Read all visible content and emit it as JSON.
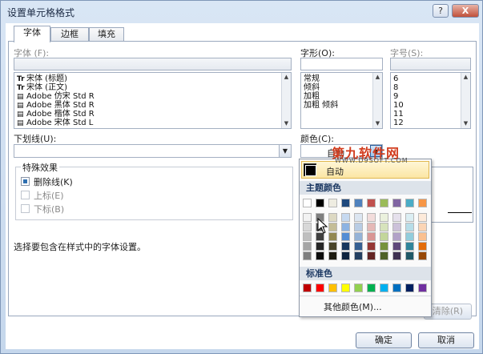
{
  "window": {
    "title": "设置单元格格式",
    "help_label": "?",
    "close_label": "X"
  },
  "tabs": [
    {
      "label": "字体"
    },
    {
      "label": "边框"
    },
    {
      "label": "填充"
    }
  ],
  "font": {
    "label": "字体 (F):",
    "value": "",
    "items": [
      {
        "icon": "Tr",
        "label": "宋体 (标题)"
      },
      {
        "icon": "Tr",
        "label": "宋体 (正文)"
      },
      {
        "icon": "",
        "label": "Adobe 仿宋 Std R"
      },
      {
        "icon": "",
        "label": "Adobe 黑体 Std R"
      },
      {
        "icon": "",
        "label": "Adobe 楷体 Std R"
      },
      {
        "icon": "",
        "label": "Adobe 宋体 Std L"
      }
    ]
  },
  "style": {
    "label": "字形(O):",
    "value": "",
    "items": [
      "常规",
      "倾斜",
      "加粗",
      "加粗 倾斜"
    ]
  },
  "size": {
    "label": "字号(S):",
    "value": "",
    "items": [
      "6",
      "8",
      "9",
      "10",
      "11",
      "12"
    ]
  },
  "underline": {
    "label": "下划线(U):",
    "value": ""
  },
  "color": {
    "label": "颜色(C):",
    "value": "自动"
  },
  "effects": {
    "title": "特殊效果",
    "strikethrough": "删除线(K)",
    "superscript": "上标(E)",
    "subscript": "下标(B)"
  },
  "hint": "选择要包含在样式中的字体设置。",
  "watermark": {
    "title": "第九软件网",
    "url": "WWW.D9SOFT.COM"
  },
  "color_popup": {
    "auto_label": "自动",
    "theme_header": "主题颜色",
    "standard_header": "标准色",
    "more_label": "其他颜色(M)...",
    "theme_top": [
      "#ffffff",
      "#000000",
      "#eeece1",
      "#1f497d",
      "#4f81bd",
      "#c0504d",
      "#9bbb59",
      "#8064a2",
      "#4bacc6",
      "#f79646"
    ],
    "theme_shades": [
      [
        "#f2f2f2",
        "#7f7f7f",
        "#ddd9c3",
        "#c6d9f0",
        "#dbe5f1",
        "#f2dcdb",
        "#ebf1dd",
        "#e5e0ec",
        "#dbeef3",
        "#fdeada"
      ],
      [
        "#d8d8d8",
        "#595959",
        "#c4bd97",
        "#8db3e2",
        "#b8cce4",
        "#e5b9b7",
        "#d7e3bc",
        "#ccc1d9",
        "#b7dde8",
        "#fbd5b5"
      ],
      [
        "#bfbfbf",
        "#3f3f3f",
        "#938953",
        "#548dd4",
        "#95b3d7",
        "#d99694",
        "#c3d69b",
        "#b2a2c7",
        "#92cddc",
        "#fac08f"
      ],
      [
        "#a5a5a5",
        "#262626",
        "#494429",
        "#17365d",
        "#366092",
        "#953734",
        "#76923c",
        "#5f497a",
        "#31859b",
        "#e36c09"
      ],
      [
        "#7f7f7f",
        "#0c0c0c",
        "#1d1b10",
        "#0f243e",
        "#244061",
        "#632423",
        "#4f6128",
        "#3f3151",
        "#205867",
        "#974806"
      ]
    ],
    "standard": [
      "#c00000",
      "#ff0000",
      "#ffc000",
      "#ffff00",
      "#92d050",
      "#00b050",
      "#00b0f0",
      "#0070c0",
      "#002060",
      "#7030a0"
    ]
  },
  "buttons": {
    "clear": "清除(R)",
    "ok": "确定",
    "cancel": "取消"
  }
}
